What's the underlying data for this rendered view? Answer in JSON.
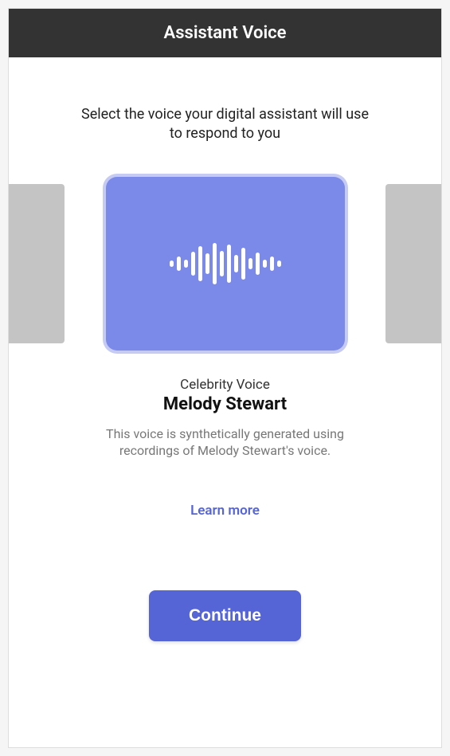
{
  "header": {
    "title": "Assistant Voice"
  },
  "instruction": "Select the voice your digital assistant will use to respond to you",
  "voice": {
    "category": "Celebrity Voice",
    "name": "Melody Stewart",
    "description": "This voice is synthetically generated using recordings of Melody Stewart's voice."
  },
  "links": {
    "learn_more": "Learn more"
  },
  "buttons": {
    "continue": "Continue"
  },
  "colors": {
    "accent": "#5665d6",
    "card": "#7b89e8",
    "card_outline": "#c5cbf3",
    "side_card": "#c4c4c4",
    "header_bg": "#333333"
  }
}
